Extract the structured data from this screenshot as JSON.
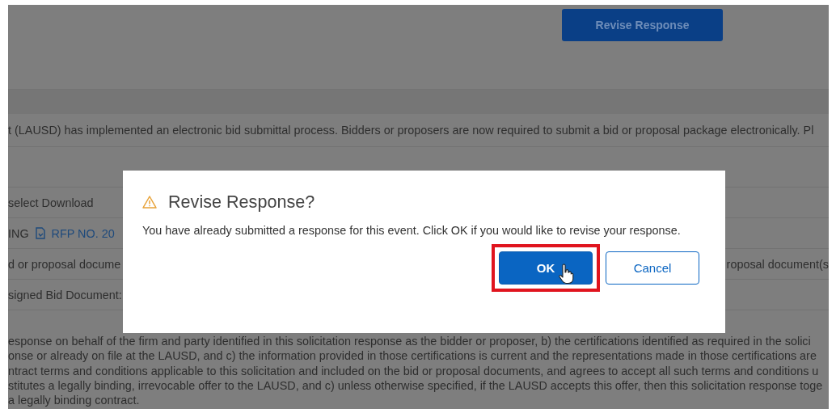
{
  "header": {
    "button": "Revise Response"
  },
  "intro": "t (LAUSD) has implemented an electronic bid submittal process. Bidders or proposers are now required to submit a bid or proposal package electronically. Pl",
  "rows": [
    {
      "left": "select Download",
      "right": ""
    },
    {
      "left": "ING",
      "link": "RFP NO. 20",
      "right": ""
    },
    {
      "left": "d or proposal docume",
      "right": "roposal document(s"
    },
    {
      "left": "signed Bid Document:",
      "right": ""
    }
  ],
  "terms": [
    "esponse on behalf of the firm and party identified in this solicitation response as the bidder or proposer, b) the certifications identified as required in the solici",
    "onse or already on file at the LAUSD, and c) the information provided in those certifications is current and the representations made in those certifications are",
    "ntract terms and conditions applicable to this solicitation and included on the bid or proposal documents, and agrees to accept all such terms and conditions u",
    "stitutes a legally binding, irrevocable offer to the LAUSD, and c) unless otherwise specified, if the LAUSD accepts this offer, then this solicitation response toge",
    "a legally binding contract."
  ],
  "dialog": {
    "title": "Revise Response?",
    "message": "You have already submitted a response for this event. Click OK if you would like to revise your response.",
    "buttons": [
      {
        "label": "OK",
        "kind": "primary",
        "highlighted": true
      },
      {
        "label": "Cancel",
        "kind": "secondary",
        "highlighted": false
      }
    ]
  }
}
